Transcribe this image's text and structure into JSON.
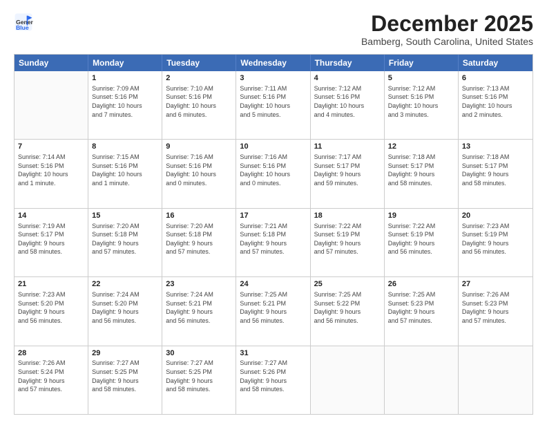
{
  "logo": {
    "general": "General",
    "blue": "Blue"
  },
  "header": {
    "month": "December 2025",
    "location": "Bamberg, South Carolina, United States"
  },
  "days": [
    "Sunday",
    "Monday",
    "Tuesday",
    "Wednesday",
    "Thursday",
    "Friday",
    "Saturday"
  ],
  "weeks": [
    [
      {
        "day": "",
        "info": ""
      },
      {
        "day": "1",
        "info": "Sunrise: 7:09 AM\nSunset: 5:16 PM\nDaylight: 10 hours\nand 7 minutes."
      },
      {
        "day": "2",
        "info": "Sunrise: 7:10 AM\nSunset: 5:16 PM\nDaylight: 10 hours\nand 6 minutes."
      },
      {
        "day": "3",
        "info": "Sunrise: 7:11 AM\nSunset: 5:16 PM\nDaylight: 10 hours\nand 5 minutes."
      },
      {
        "day": "4",
        "info": "Sunrise: 7:12 AM\nSunset: 5:16 PM\nDaylight: 10 hours\nand 4 minutes."
      },
      {
        "day": "5",
        "info": "Sunrise: 7:12 AM\nSunset: 5:16 PM\nDaylight: 10 hours\nand 3 minutes."
      },
      {
        "day": "6",
        "info": "Sunrise: 7:13 AM\nSunset: 5:16 PM\nDaylight: 10 hours\nand 2 minutes."
      }
    ],
    [
      {
        "day": "7",
        "info": "Sunrise: 7:14 AM\nSunset: 5:16 PM\nDaylight: 10 hours\nand 1 minute."
      },
      {
        "day": "8",
        "info": "Sunrise: 7:15 AM\nSunset: 5:16 PM\nDaylight: 10 hours\nand 1 minute."
      },
      {
        "day": "9",
        "info": "Sunrise: 7:16 AM\nSunset: 5:16 PM\nDaylight: 10 hours\nand 0 minutes."
      },
      {
        "day": "10",
        "info": "Sunrise: 7:16 AM\nSunset: 5:16 PM\nDaylight: 10 hours\nand 0 minutes."
      },
      {
        "day": "11",
        "info": "Sunrise: 7:17 AM\nSunset: 5:17 PM\nDaylight: 9 hours\nand 59 minutes."
      },
      {
        "day": "12",
        "info": "Sunrise: 7:18 AM\nSunset: 5:17 PM\nDaylight: 9 hours\nand 58 minutes."
      },
      {
        "day": "13",
        "info": "Sunrise: 7:18 AM\nSunset: 5:17 PM\nDaylight: 9 hours\nand 58 minutes."
      }
    ],
    [
      {
        "day": "14",
        "info": "Sunrise: 7:19 AM\nSunset: 5:17 PM\nDaylight: 9 hours\nand 58 minutes."
      },
      {
        "day": "15",
        "info": "Sunrise: 7:20 AM\nSunset: 5:18 PM\nDaylight: 9 hours\nand 57 minutes."
      },
      {
        "day": "16",
        "info": "Sunrise: 7:20 AM\nSunset: 5:18 PM\nDaylight: 9 hours\nand 57 minutes."
      },
      {
        "day": "17",
        "info": "Sunrise: 7:21 AM\nSunset: 5:18 PM\nDaylight: 9 hours\nand 57 minutes."
      },
      {
        "day": "18",
        "info": "Sunrise: 7:22 AM\nSunset: 5:19 PM\nDaylight: 9 hours\nand 57 minutes."
      },
      {
        "day": "19",
        "info": "Sunrise: 7:22 AM\nSunset: 5:19 PM\nDaylight: 9 hours\nand 56 minutes."
      },
      {
        "day": "20",
        "info": "Sunrise: 7:23 AM\nSunset: 5:19 PM\nDaylight: 9 hours\nand 56 minutes."
      }
    ],
    [
      {
        "day": "21",
        "info": "Sunrise: 7:23 AM\nSunset: 5:20 PM\nDaylight: 9 hours\nand 56 minutes."
      },
      {
        "day": "22",
        "info": "Sunrise: 7:24 AM\nSunset: 5:20 PM\nDaylight: 9 hours\nand 56 minutes."
      },
      {
        "day": "23",
        "info": "Sunrise: 7:24 AM\nSunset: 5:21 PM\nDaylight: 9 hours\nand 56 minutes."
      },
      {
        "day": "24",
        "info": "Sunrise: 7:25 AM\nSunset: 5:21 PM\nDaylight: 9 hours\nand 56 minutes."
      },
      {
        "day": "25",
        "info": "Sunrise: 7:25 AM\nSunset: 5:22 PM\nDaylight: 9 hours\nand 56 minutes."
      },
      {
        "day": "26",
        "info": "Sunrise: 7:25 AM\nSunset: 5:23 PM\nDaylight: 9 hours\nand 57 minutes."
      },
      {
        "day": "27",
        "info": "Sunrise: 7:26 AM\nSunset: 5:23 PM\nDaylight: 9 hours\nand 57 minutes."
      }
    ],
    [
      {
        "day": "28",
        "info": "Sunrise: 7:26 AM\nSunset: 5:24 PM\nDaylight: 9 hours\nand 57 minutes."
      },
      {
        "day": "29",
        "info": "Sunrise: 7:27 AM\nSunset: 5:25 PM\nDaylight: 9 hours\nand 58 minutes."
      },
      {
        "day": "30",
        "info": "Sunrise: 7:27 AM\nSunset: 5:25 PM\nDaylight: 9 hours\nand 58 minutes."
      },
      {
        "day": "31",
        "info": "Sunrise: 7:27 AM\nSunset: 5:26 PM\nDaylight: 9 hours\nand 58 minutes."
      },
      {
        "day": "",
        "info": ""
      },
      {
        "day": "",
        "info": ""
      },
      {
        "day": "",
        "info": ""
      }
    ]
  ]
}
